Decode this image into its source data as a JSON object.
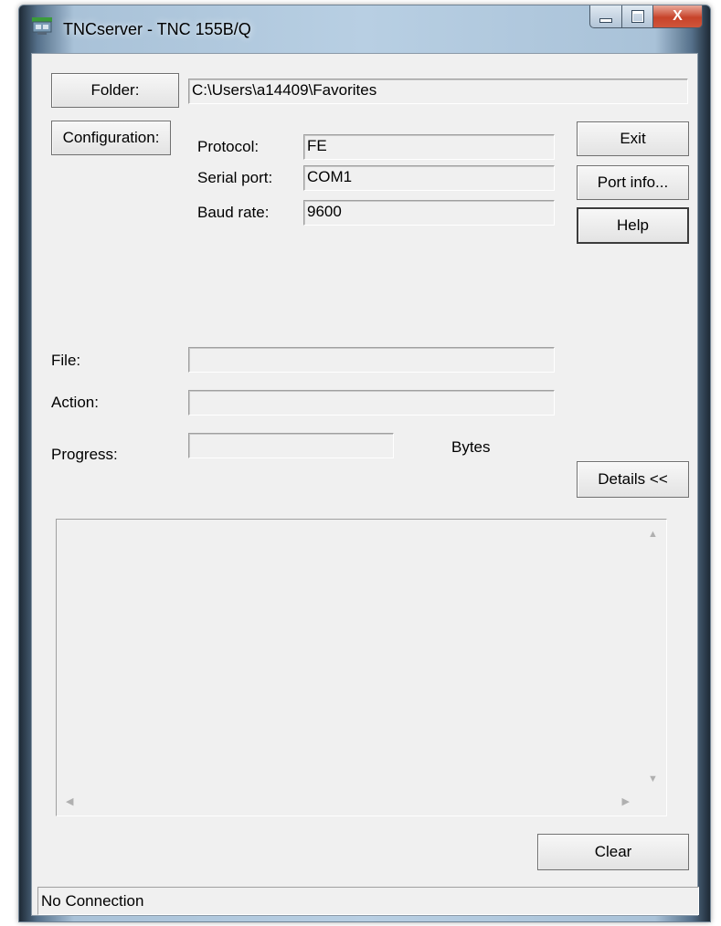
{
  "window": {
    "title": "TNCserver - TNC 155B/Q",
    "close_glyph": "X",
    "icons": {
      "app": "tncserver-app-icon",
      "minimize": "minimize-icon",
      "maximize": "maximize-icon",
      "close": "close-icon"
    }
  },
  "folder": {
    "button_label": "Folder:",
    "path": "C:\\Users\\a14409\\Favorites"
  },
  "configuration": {
    "button_label": "Configuration:",
    "protocol_label": "Protocol:",
    "protocol_value": "FE",
    "serial_port_label": "Serial port:",
    "serial_port_value": "COM1",
    "baud_rate_label": "Baud rate:",
    "baud_rate_value": "9600"
  },
  "buttons": {
    "exit": "Exit",
    "port_info": "Port info...",
    "help": "Help",
    "details": "Details <<",
    "clear": "Clear"
  },
  "transfer": {
    "file_label": "File:",
    "file_value": "",
    "action_label": "Action:",
    "action_value": "",
    "progress_label": "Progress:",
    "progress_value": "",
    "bytes_label": "Bytes"
  },
  "log": {
    "content": ""
  },
  "status": {
    "text": "No Connection"
  },
  "colors": {
    "face": "#f0f0f0",
    "close_button": "#c7432a",
    "frame": "#b8cfe3"
  }
}
